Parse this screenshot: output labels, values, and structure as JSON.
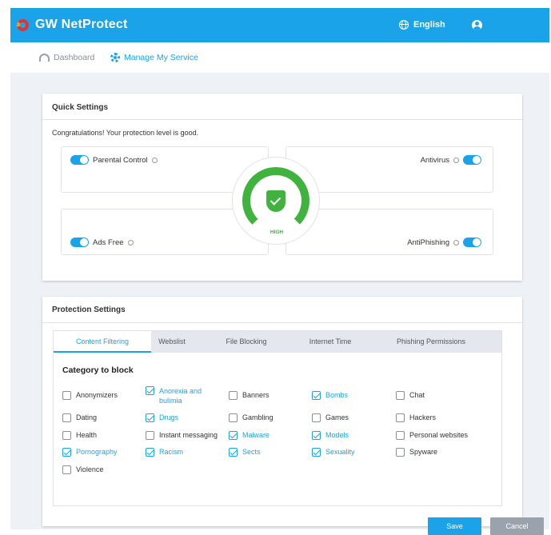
{
  "app": {
    "brand": "GW NetProtect",
    "language": "English"
  },
  "colors": {
    "accent": "#1aa3e8",
    "good": "#3fb33d",
    "cancel": "#9aa3ad"
  },
  "nav": {
    "dashboard": "Dashboard",
    "manage": "Manage My Service"
  },
  "quick_settings": {
    "title": "Quick Settings",
    "message": "Congratulations! Your protection level is good.",
    "parental_control": "Parental Control",
    "antivirus": "Antivirus",
    "ads_free": "Ads Free",
    "antiphishing": "AntiPhishing",
    "level": "HIGH"
  },
  "protection": {
    "title": "Protection Settings",
    "tabs": [
      "Content Filtering",
      "Webslist",
      "File Blocking",
      "Internet Time",
      "Phishing Permissions"
    ],
    "category_title": "Category to block",
    "categories": [
      {
        "label": "Anonymizers",
        "checked": false
      },
      {
        "label": "Anorexia and bulimia",
        "checked": true
      },
      {
        "label": "Banners",
        "checked": false
      },
      {
        "label": "Bombs",
        "checked": true
      },
      {
        "label": "Chat",
        "checked": false
      },
      {
        "label": "Dating",
        "checked": false
      },
      {
        "label": "Drugs",
        "checked": true
      },
      {
        "label": "Gambling",
        "checked": false
      },
      {
        "label": "Games",
        "checked": false
      },
      {
        "label": "Hackers",
        "checked": false
      },
      {
        "label": "Health",
        "checked": false
      },
      {
        "label": "Instant messaging",
        "checked": false
      },
      {
        "label": "Malware",
        "checked": true
      },
      {
        "label": "Models",
        "checked": true
      },
      {
        "label": "Personal websites",
        "checked": false
      },
      {
        "label": "Pornography",
        "checked": true
      },
      {
        "label": "Racism",
        "checked": true
      },
      {
        "label": "Sects",
        "checked": true
      },
      {
        "label": "Sexuality",
        "checked": true
      },
      {
        "label": "Spyware",
        "checked": false
      },
      {
        "label": "Violence",
        "checked": false
      }
    ],
    "save": "Save",
    "cancel": "Cancel"
  }
}
